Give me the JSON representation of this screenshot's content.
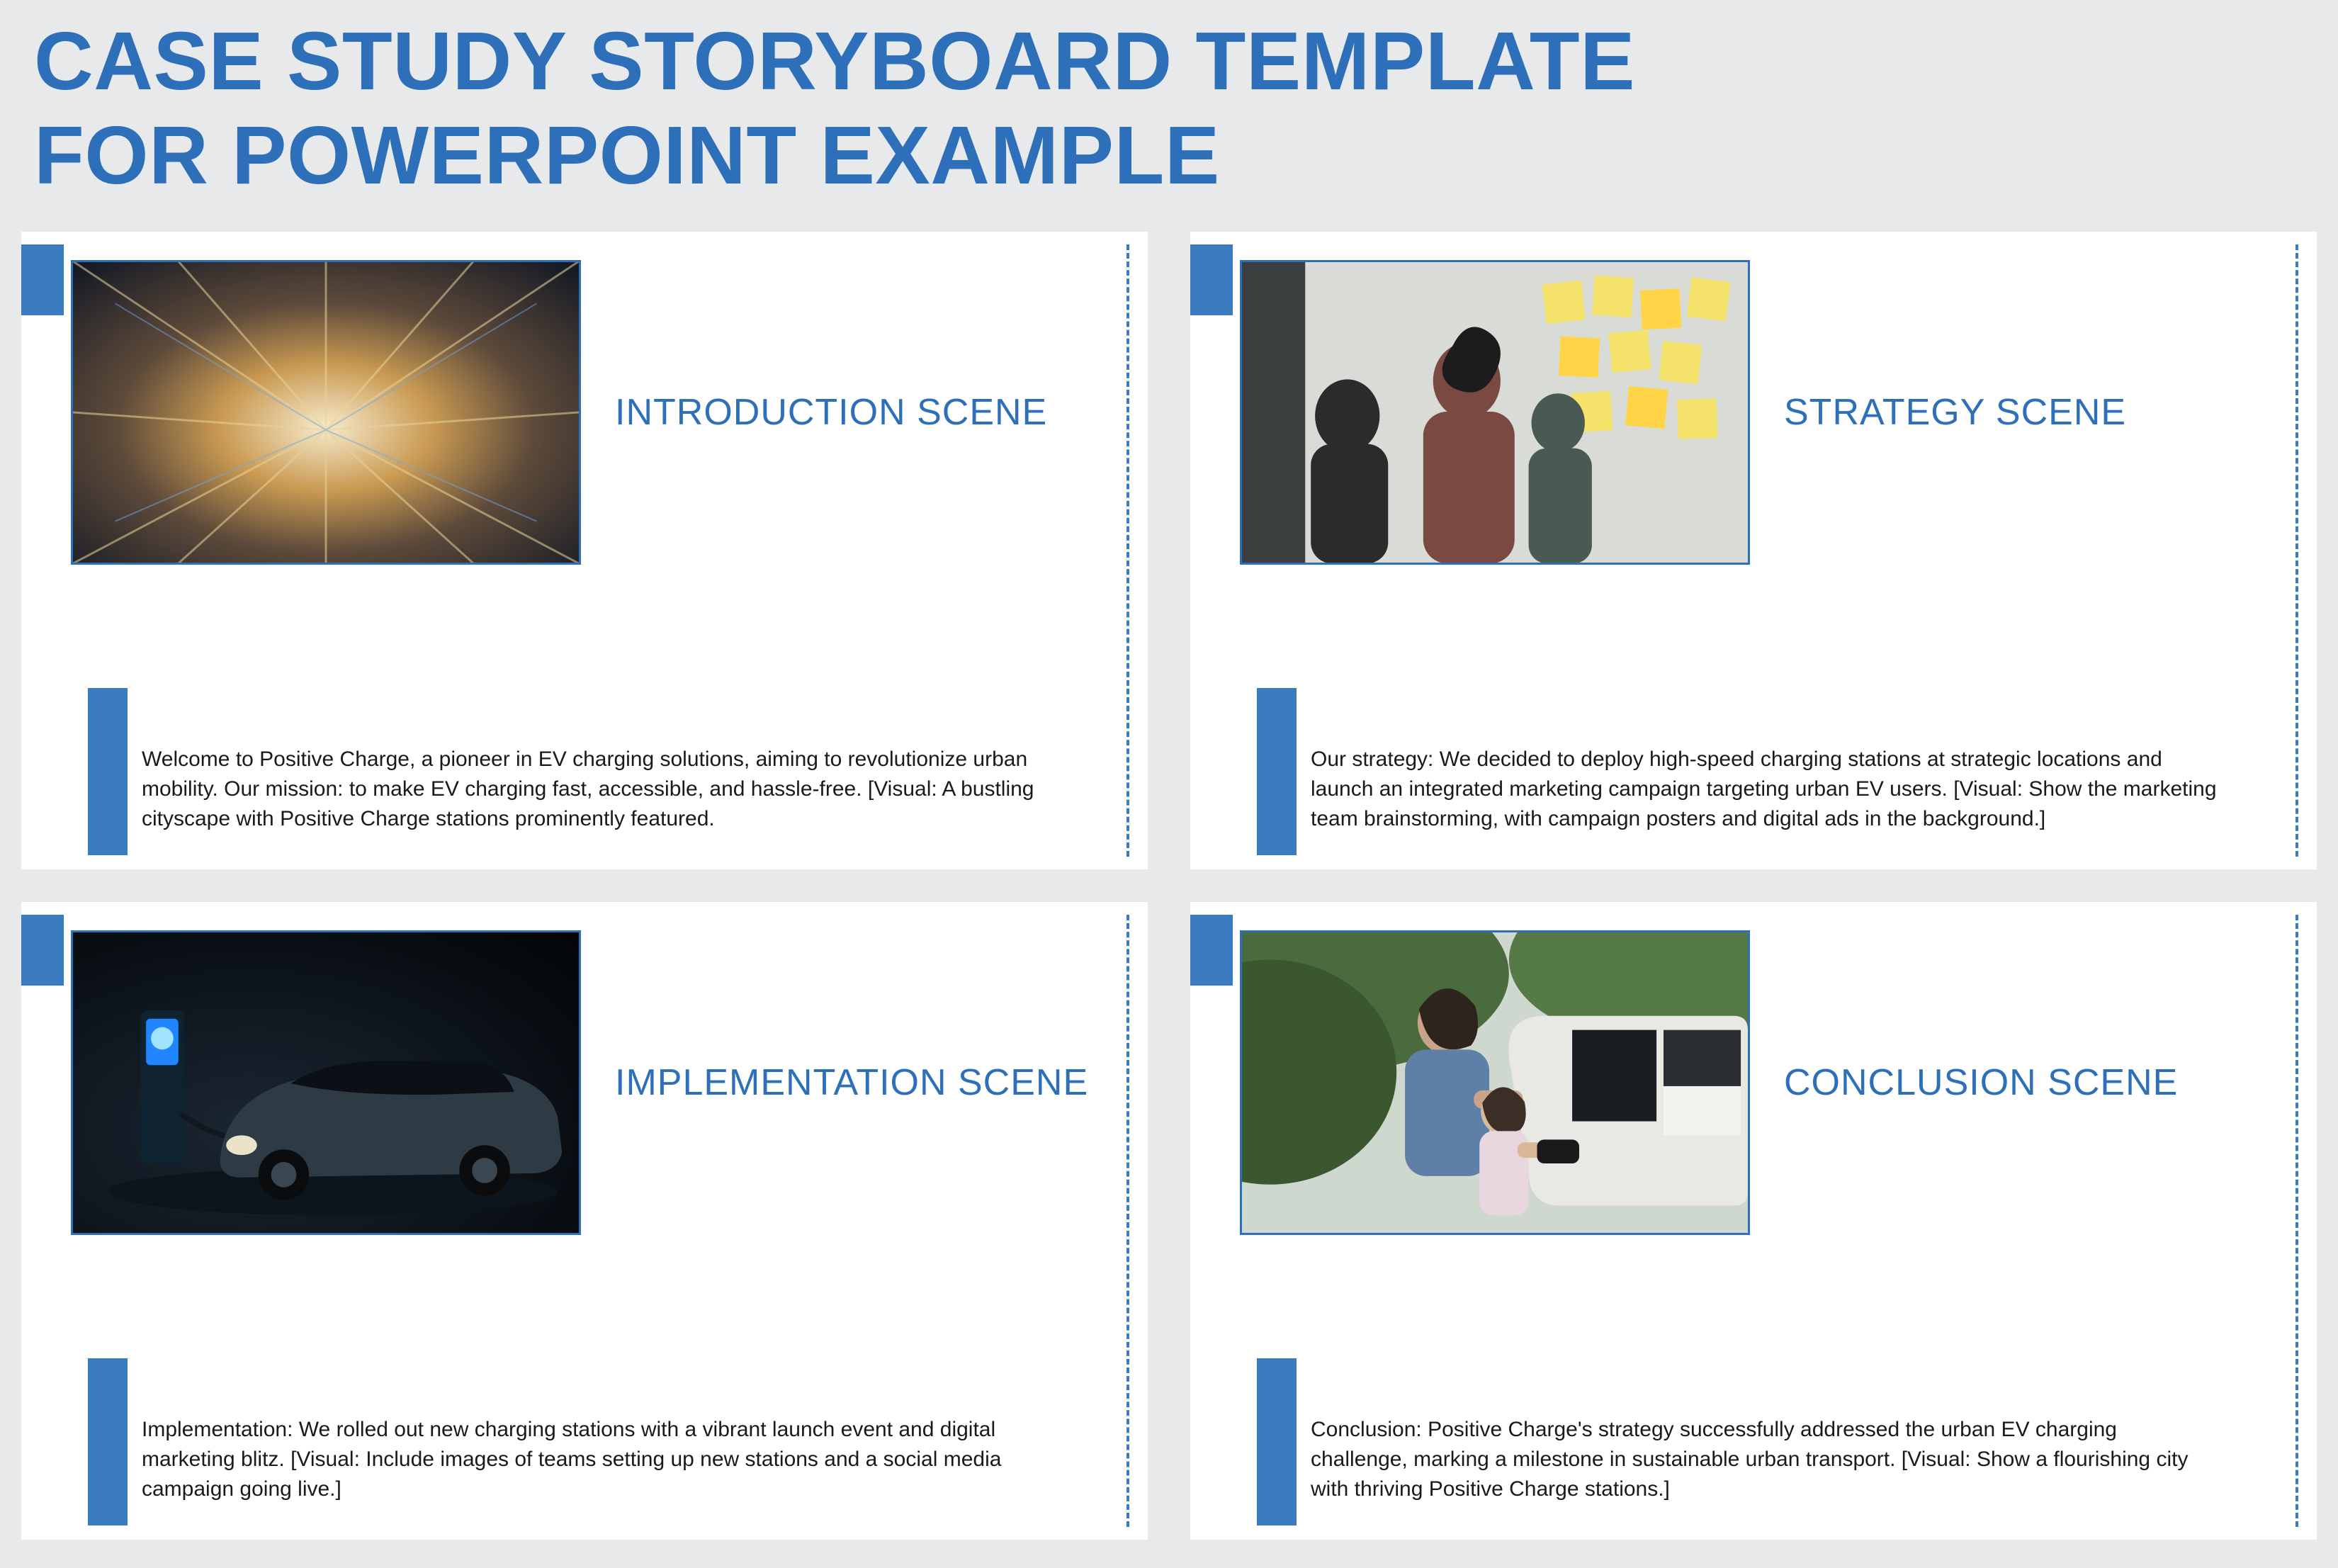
{
  "title_line1": "CASE STUDY STORYBOARD TEMPLATE",
  "title_line2": "FOR POWERPOINT EXAMPLE",
  "colors": {
    "accent": "#2d6fb8",
    "bar": "#3b7cc0",
    "page_bg": "#e8e9ea"
  },
  "cards": [
    {
      "scene_title": "INTRODUCTION SCENE",
      "image_alt": "motion-blur tunnel cityscape",
      "body": "Welcome to Positive Charge, a pioneer in EV charging solutions, aiming to revolutionize urban mobility. Our mission: to make EV charging fast, accessible, and hassle-free. [Visual: A bustling cityscape with Positive Charge stations prominently featured."
    },
    {
      "scene_title": "STRATEGY SCENE",
      "image_alt": "marketing team brainstorming at sticky-note board",
      "body": "Our strategy: We decided to deploy high-speed charging stations at strategic locations and launch an integrated marketing campaign targeting urban EV users. [Visual: Show the marketing team brainstorming, with campaign posters and digital ads in the background.]"
    },
    {
      "scene_title": "IMPLEMENTATION SCENE",
      "image_alt": "electric car at charging station in dark studio",
      "body": "Implementation: We rolled out new charging stations with a vibrant launch event and digital marketing blitz. [Visual: Include images of teams setting up new stations and a social media campaign going live.]"
    },
    {
      "scene_title": "CONCLUSION SCENE",
      "image_alt": "mother and child plugging in EV outdoors",
      "body": "Conclusion: Positive Charge's strategy successfully addressed the urban EV charging challenge, marking a milestone in sustainable urban transport. [Visual: Show a flourishing city with thriving Positive Charge stations.]"
    }
  ]
}
